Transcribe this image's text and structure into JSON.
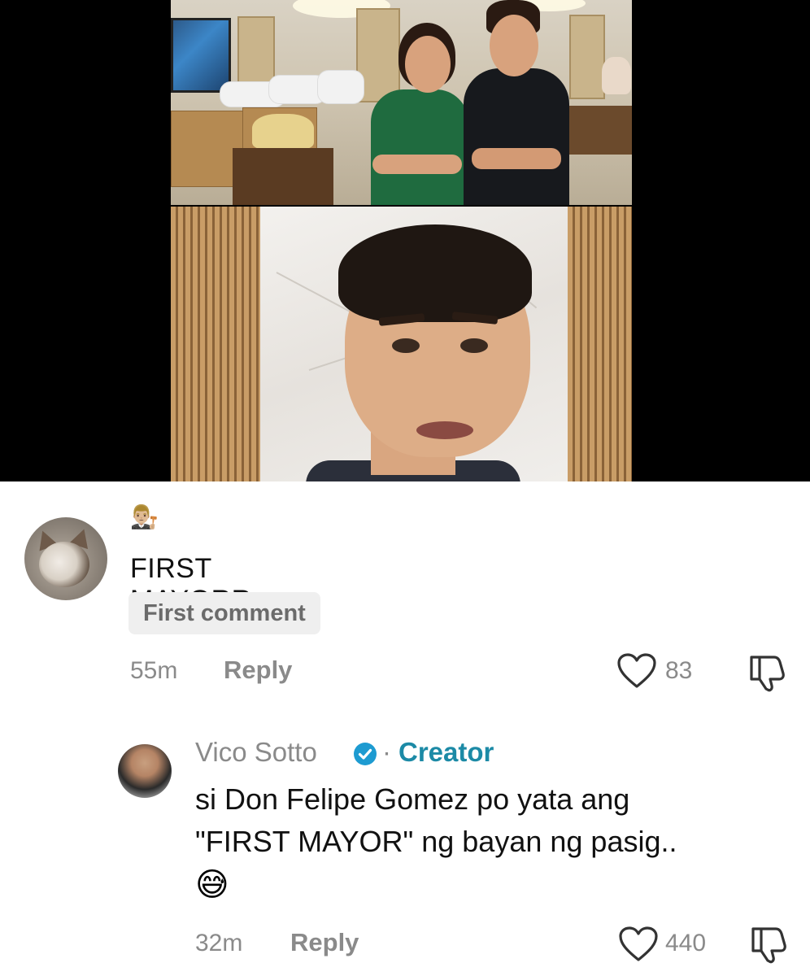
{
  "comments": [
    {
      "badge_emoji": "👨🏼‍⚖️",
      "text": "FIRST MAYORR",
      "tag": "First comment",
      "time": "55m",
      "reply_label": "Reply",
      "likes": "83"
    },
    {
      "author": "Vico Sotto",
      "separator": "·",
      "role": "Creator",
      "lines": [
        "si Don Felipe Gomez po yata ang",
        "\"FIRST MAYOR\" ng bayan ng pasig.."
      ],
      "emoji": "😅",
      "time": "32m",
      "reply_label": "Reply",
      "likes": "440"
    }
  ],
  "colors": {
    "creator_accent": "#1c8aa6",
    "verified_badge": "#1d9bd1",
    "meta_gray": "#8a8a8a",
    "tag_bg": "#efefef"
  },
  "icons": {
    "like": "heart-outline-icon",
    "dislike": "thumbs-down-outline-icon",
    "verified": "verified-check-icon"
  }
}
